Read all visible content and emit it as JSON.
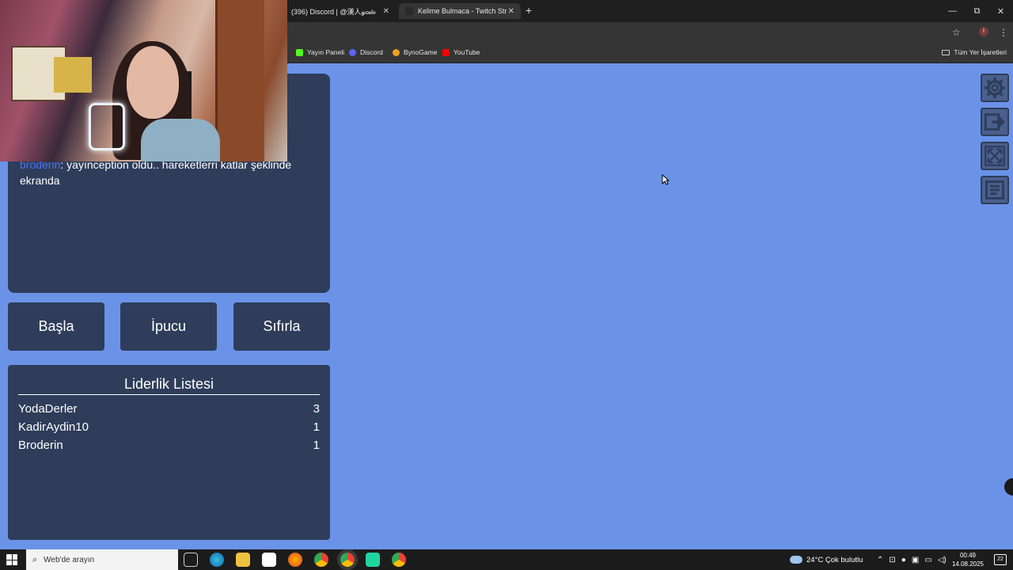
{
  "browser": {
    "tabs": [
      {
        "title": "(396) Discord | @漢人𝓎𝑜𝒹𝒶",
        "favicon_color": "#5865f2"
      },
      {
        "title": "Kelime Bulmaca - Twitch Stream",
        "favicon_color": "#1f1f1f"
      }
    ],
    "new_tab": "+",
    "window_controls": {
      "minimize": "—",
      "restore": "⧉",
      "close": "✕"
    },
    "bookmarks": [
      {
        "label": "Yayın Paneli",
        "color": "#53fc18"
      },
      {
        "label": "Discord",
        "color": "#5865f2"
      },
      {
        "label": "BynoGame",
        "color": "#f0a020"
      },
      {
        "label": "YouTube",
        "color": "#ff0000"
      }
    ],
    "all_bookmarks": "Tüm Yer İşaretleri",
    "profile_initial": "I"
  },
  "chat": {
    "user": "broderin",
    "message": ": yayınception oldu.. hareketlerri katlar şeklinde ekranda"
  },
  "buttons": {
    "start": "Başla",
    "hint": "İpucu",
    "reset": "Sıfırla"
  },
  "leaderboard": {
    "title": "Liderlik Listesi",
    "rows": [
      {
        "name": "YodaDerler",
        "score": "3"
      },
      {
        "name": "KadirAydin10",
        "score": "1"
      },
      {
        "name": "Broderin",
        "score": "1"
      }
    ]
  },
  "tools": [
    "gear-icon",
    "exit-icon",
    "fullscreen-icon",
    "notes-icon"
  ],
  "taskbar": {
    "search_placeholder": "Web'de arayın",
    "weather": "24°C  Çok bulutlu",
    "time": "00:49",
    "date": "14.08.2025",
    "notifications": "22"
  },
  "colors": {
    "background": "#6a93e8",
    "panel": "#2f3d5a",
    "chat_user": "#4b6ff0"
  }
}
